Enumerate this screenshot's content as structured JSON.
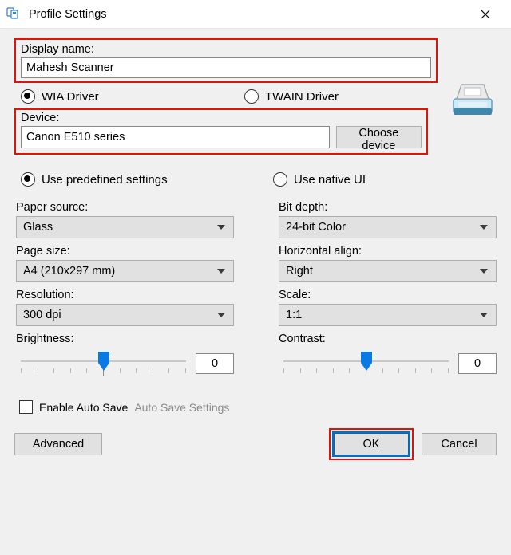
{
  "window": {
    "title": "Profile Settings"
  },
  "display_name": {
    "label": "Display name:",
    "value": "Mahesh Scanner"
  },
  "driver": {
    "wia": "WIA Driver",
    "twain": "TWAIN Driver",
    "selected": "wia"
  },
  "device": {
    "label": "Device:",
    "value": "Canon E510 series",
    "choose_button": "Choose device"
  },
  "settings_mode": {
    "predefined": "Use predefined settings",
    "native": "Use native UI",
    "selected": "predefined"
  },
  "left": {
    "paper_source": {
      "label": "Paper source:",
      "value": "Glass"
    },
    "page_size": {
      "label": "Page size:",
      "value": "A4 (210x297 mm)"
    },
    "resolution": {
      "label": "Resolution:",
      "value": "300 dpi"
    },
    "brightness": {
      "label": "Brightness:",
      "value": "0"
    }
  },
  "right": {
    "bit_depth": {
      "label": "Bit depth:",
      "value": "24-bit Color"
    },
    "halign": {
      "label": "Horizontal align:",
      "value": "Right"
    },
    "scale": {
      "label": "Scale:",
      "value": "1:1"
    },
    "contrast": {
      "label": "Contrast:",
      "value": "0"
    }
  },
  "auto_save": {
    "checkbox_label": "Enable Auto Save",
    "link_label": "Auto Save Settings",
    "checked": false
  },
  "buttons": {
    "advanced": "Advanced",
    "ok": "OK",
    "cancel": "Cancel"
  }
}
